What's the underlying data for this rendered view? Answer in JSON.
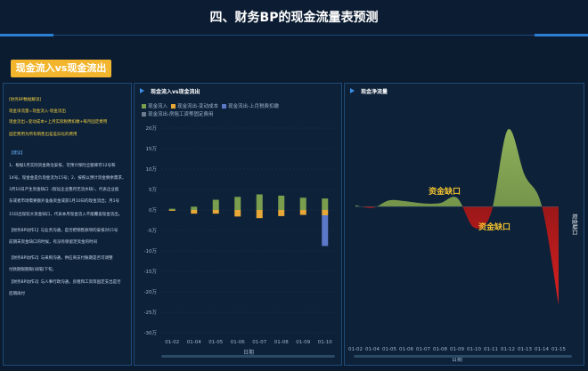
{
  "page": {
    "title": "四、财务BP的现金流量表预测"
  },
  "section": {
    "badge": "现金流入vs现金流出"
  },
  "left_panel": {
    "lines": [
      {
        "text": "[财务BP数据解读]",
        "style": "y"
      },
      {
        "text": "现金净流量=现金流入-现金流出",
        "style": "y"
      },
      {
        "text": "现金流出=变动成本+上月实际税费扣缴+每月固定费用",
        "style": "y"
      },
      {
        "text": "固定费用为所有销售出差差异化的费用",
        "style": "y"
      },
      {
        "text": "【建议】",
        "style": "b"
      },
      {
        "text": "1、根据1月实际资金政治安排，可预计保险全额库存12号和",
        "style": "w"
      },
      {
        "text": "14号。现金金是负现金流为15号；2、按照以预计资金剩余需求，",
        "style": "w"
      },
      {
        "text": "3月10日产生资金缺口（假设企业整月无流水缺），代表企业股",
        "style": "w"
      },
      {
        "text": "东或者市场需要额外准备资金或获1月10日的现金流出；月1号",
        "style": "w"
      },
      {
        "text": "15日出现较大资金缺口，代表本月现金流入不能覆盖现金流出。",
        "style": "w"
      },
      {
        "text": "【财务BP动作1】与业务沟通，是否把销售款项的安排对15号",
        "style": "w"
      },
      {
        "text": "前期末资金缺口的时候，有没有保留足资金的时间",
        "style": "w"
      },
      {
        "text": "【财务BP动作2】与采购沟通，供应商支付账期是否可调整",
        "style": "w"
      },
      {
        "text": "付款期限期限(间隔)下旬。",
        "style": "w"
      },
      {
        "text": "【财务BP动作3】与人事行政沟通，房租和工资等固定支出是否",
        "style": "w"
      },
      {
        "text": "后期再付",
        "style": "w"
      }
    ]
  },
  "mid_panel": {
    "title": "现金流入vs现金流出",
    "legend": [
      {
        "label": "现金流入",
        "color": "#7a9e4e"
      },
      {
        "label": "现金流出-变动成本",
        "color": "#e8a838"
      },
      {
        "label": "现金流出-上月税费扣缴",
        "color": "#5b79c8"
      },
      {
        "label": "现金流出-房租工资等固定费用",
        "color": "#6d7c8e"
      }
    ]
  },
  "right_panel": {
    "title": "现金净流量"
  },
  "chart_data": [
    {
      "type": "bar",
      "title": "现金流入vs现金流出",
      "xlabel": "日期",
      "ylabel": "",
      "ylim": [
        -30,
        20
      ],
      "yticks": [
        "20万",
        "15万",
        "10万",
        "5万",
        "0万",
        "-5万",
        "-10万",
        "-15万",
        "-20万",
        "-25万",
        "-30万"
      ],
      "ytick_values": [
        20,
        15,
        10,
        5,
        0,
        -5,
        -10,
        -15,
        -20,
        -25,
        -30
      ],
      "categories": [
        "01-02",
        "01-04",
        "01-05",
        "01-06",
        "01-07",
        "01-08",
        "01-09",
        "01-10"
      ],
      "series": [
        {
          "name": "现金流入",
          "color": "#7a9e4e",
          "values": [
            0.3,
            0.8,
            2.5,
            3.2,
            3.8,
            3.5,
            3.0,
            2.8
          ]
        },
        {
          "name": "现金流出-变动成本",
          "color": "#e8a838",
          "values": [
            -0.2,
            -0.9,
            -0.9,
            -1.6,
            -2.0,
            -1.5,
            -1.2,
            -1.3
          ]
        },
        {
          "name": "现金流出-上月税费扣缴",
          "color": "#5b79c8",
          "values": [
            0,
            0,
            0,
            0,
            0,
            0,
            0,
            -7.5
          ]
        },
        {
          "name": "现金流出-房租工资等固定费用",
          "color": "#6d7c8e",
          "values": [
            0,
            0,
            0,
            0,
            0,
            0,
            0,
            0
          ]
        }
      ]
    },
    {
      "type": "area",
      "title": "现金净流量",
      "xlabel": "日期",
      "ylabel": "",
      "categories": [
        "01-02",
        "01-04",
        "01-05",
        "01-06",
        "01-07",
        "01-08",
        "01-09",
        "01-10",
        "01-11",
        "01-12",
        "01-13",
        "01-14",
        "01-15"
      ],
      "values": [
        0.4,
        -0.4,
        1.8,
        1.5,
        0.9,
        1.0,
        2.5,
        -6.0,
        -2.0,
        22.0,
        9.0,
        0.3,
        -28.0
      ],
      "ylim": [
        -30,
        25
      ],
      "annotations": [
        {
          "text": "资金缺口",
          "color": "#f2c230"
        },
        {
          "text": "资金缺口",
          "color": "#f2c230"
        },
        {
          "text": "现金缺口",
          "color": "#ffffff"
        }
      ],
      "colors": {
        "positive": "#8fb05a",
        "negative": "#d82020"
      }
    }
  ]
}
